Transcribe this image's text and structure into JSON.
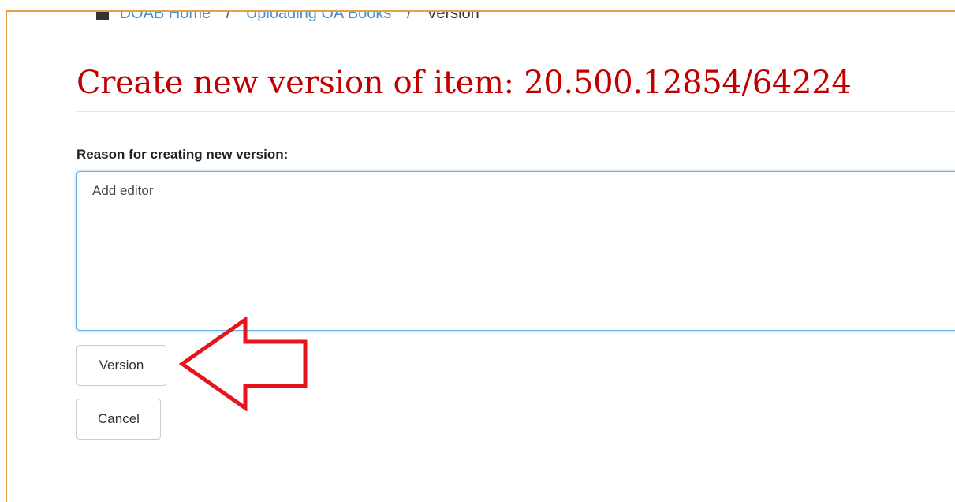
{
  "breadcrumb": {
    "items": [
      "DOAB Home",
      "Uploading OA Books",
      "Version"
    ],
    "separator": "/"
  },
  "page": {
    "title": "Create new version of item: 20.500.12854/64224"
  },
  "form": {
    "reason_label": "Reason for creating new version:",
    "reason_value": "Add editor",
    "version_button": "Version",
    "cancel_button": "Cancel"
  },
  "colors": {
    "title": "#c00000",
    "annotation_arrow": "#e8141b",
    "frame_border": "#e5a04a"
  }
}
